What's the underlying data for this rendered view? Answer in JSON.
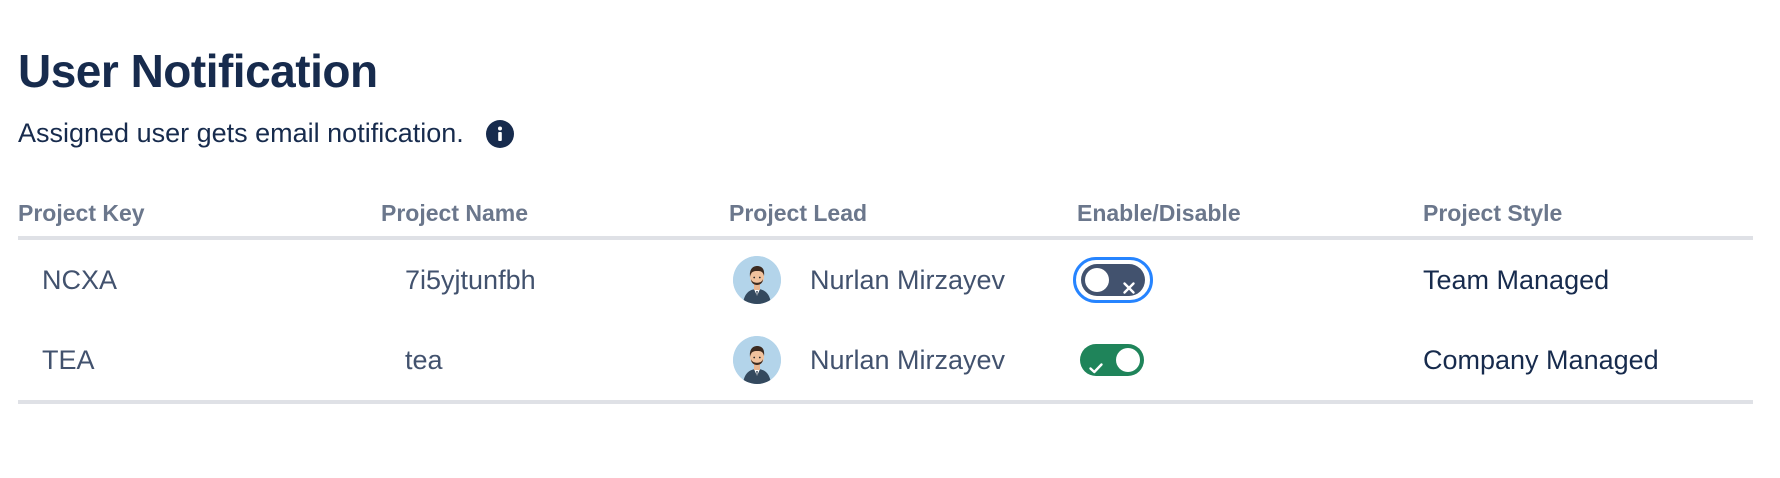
{
  "header": {
    "title": "User Notification",
    "subtitle": "Assigned user gets email notification."
  },
  "table": {
    "columns": [
      "Project Key",
      "Project Name",
      "Project Lead",
      "Enable/Disable",
      "Project Style"
    ],
    "rows": [
      {
        "key": "NCXA",
        "name": "7i5yjtunfbh",
        "lead": "Nurlan Mirzayev",
        "enabled": false,
        "focused": true,
        "style": "Team Managed"
      },
      {
        "key": "TEA",
        "name": "tea",
        "lead": "Nurlan Mirzayev",
        "enabled": true,
        "focused": false,
        "style": "Company Managed"
      }
    ]
  },
  "icons": {
    "info": "info-icon",
    "toggle_off": "close-icon",
    "toggle_on": "check-icon",
    "avatar": "avatar"
  },
  "colors": {
    "heading": "#172b4d",
    "column_header": "#6b778c",
    "toggle_off": "#42526e",
    "toggle_on": "#1f845a",
    "focus_ring": "#2684ff",
    "divider": "#dfe1e6"
  }
}
